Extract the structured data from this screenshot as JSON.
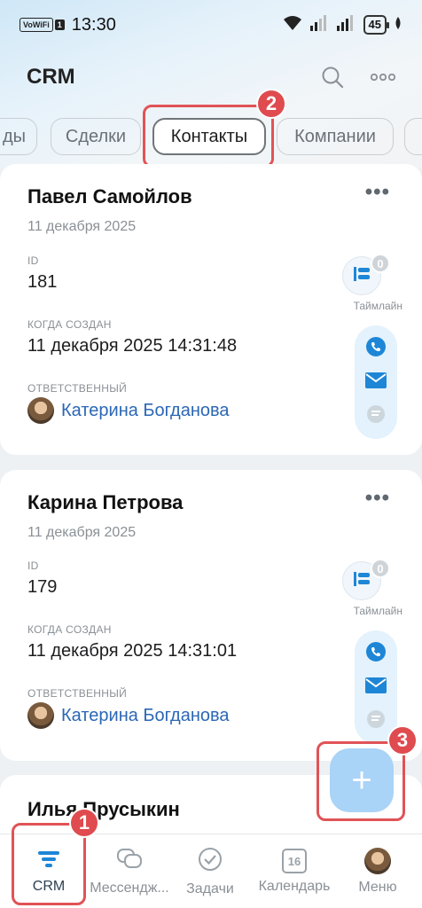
{
  "status_bar": {
    "network_badge": "VoWiFi",
    "sim": "1",
    "time": "13:30",
    "battery": "45"
  },
  "header": {
    "title": "CRM"
  },
  "tabs": [
    {
      "label": "ды"
    },
    {
      "label": "Сделки"
    },
    {
      "label": "Контакты"
    },
    {
      "label": "Компании"
    }
  ],
  "annotations": {
    "one": "1",
    "two": "2",
    "three": "3"
  },
  "contacts": [
    {
      "name": "Павел Самойлов",
      "date": "11 декабря 2025",
      "id_label": "ID",
      "id": "181",
      "created_label": "КОГДА СОЗДАН",
      "created": "11 декабря 2025 14:31:48",
      "responsible_label": "ОТВЕТСТВЕННЫЙ",
      "responsible": "Катерина Богданова",
      "timeline_label": "Таймлайн",
      "timeline_count": "0"
    },
    {
      "name": "Карина Петрова",
      "date": "11 декабря 2025",
      "id_label": "ID",
      "id": "179",
      "created_label": "КОГДА СОЗДАН",
      "created": "11 декабря 2025 14:31:01",
      "responsible_label": "ОТВЕТСТВЕННЫЙ",
      "responsible": "Катерина Богданова",
      "timeline_label": "Таймлайн",
      "timeline_count": "0"
    },
    {
      "name": "Илья Прусыкин"
    }
  ],
  "fab": {
    "label": "+"
  },
  "bottom_nav": [
    {
      "label": "CRM"
    },
    {
      "label": "Мессендж..."
    },
    {
      "label": "Задачи"
    },
    {
      "label": "Календарь",
      "day": "16"
    },
    {
      "label": "Меню"
    }
  ],
  "colors": {
    "accent": "#2b67b5",
    "annotation": "#df4b4f",
    "fab": "#a9d3f7",
    "phone": "#1e86d6"
  }
}
